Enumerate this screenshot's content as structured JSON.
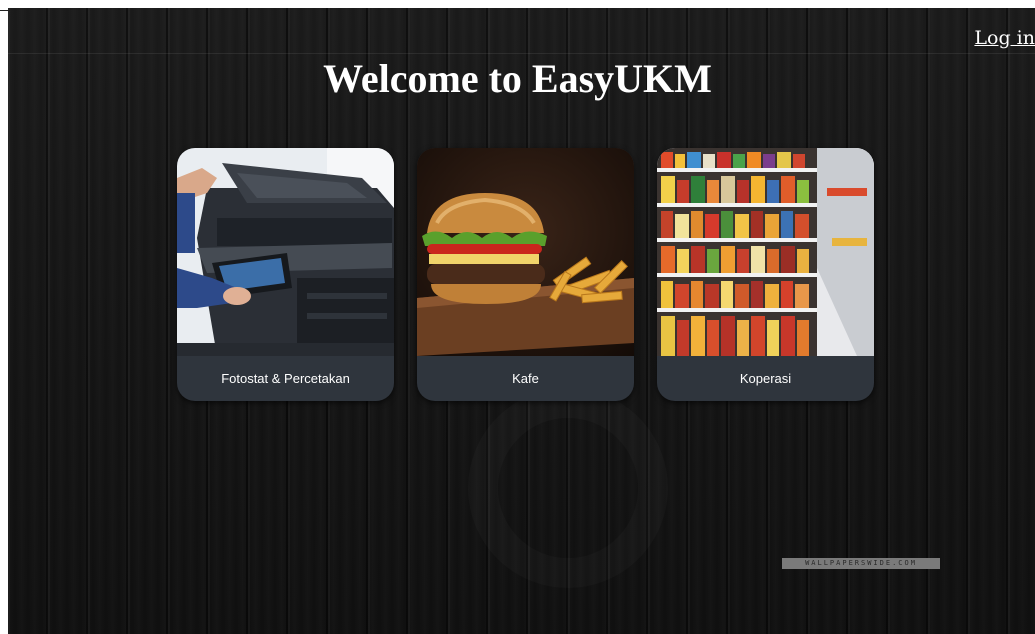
{
  "header": {
    "title": "Welcome to EasyUKM",
    "login_label": "Log in"
  },
  "cards": [
    {
      "label": "Fotostat & Percetakan",
      "icon": "photocopier-image"
    },
    {
      "label": "Kafe",
      "icon": "burger-fries-image"
    },
    {
      "label": "Koperasi",
      "icon": "store-shelves-image"
    }
  ],
  "background": {
    "watermark_text": "WALLPAPERSWIDE.COM"
  },
  "colors": {
    "background": "#151515",
    "card": "#2f353d",
    "text": "#ffffff"
  }
}
